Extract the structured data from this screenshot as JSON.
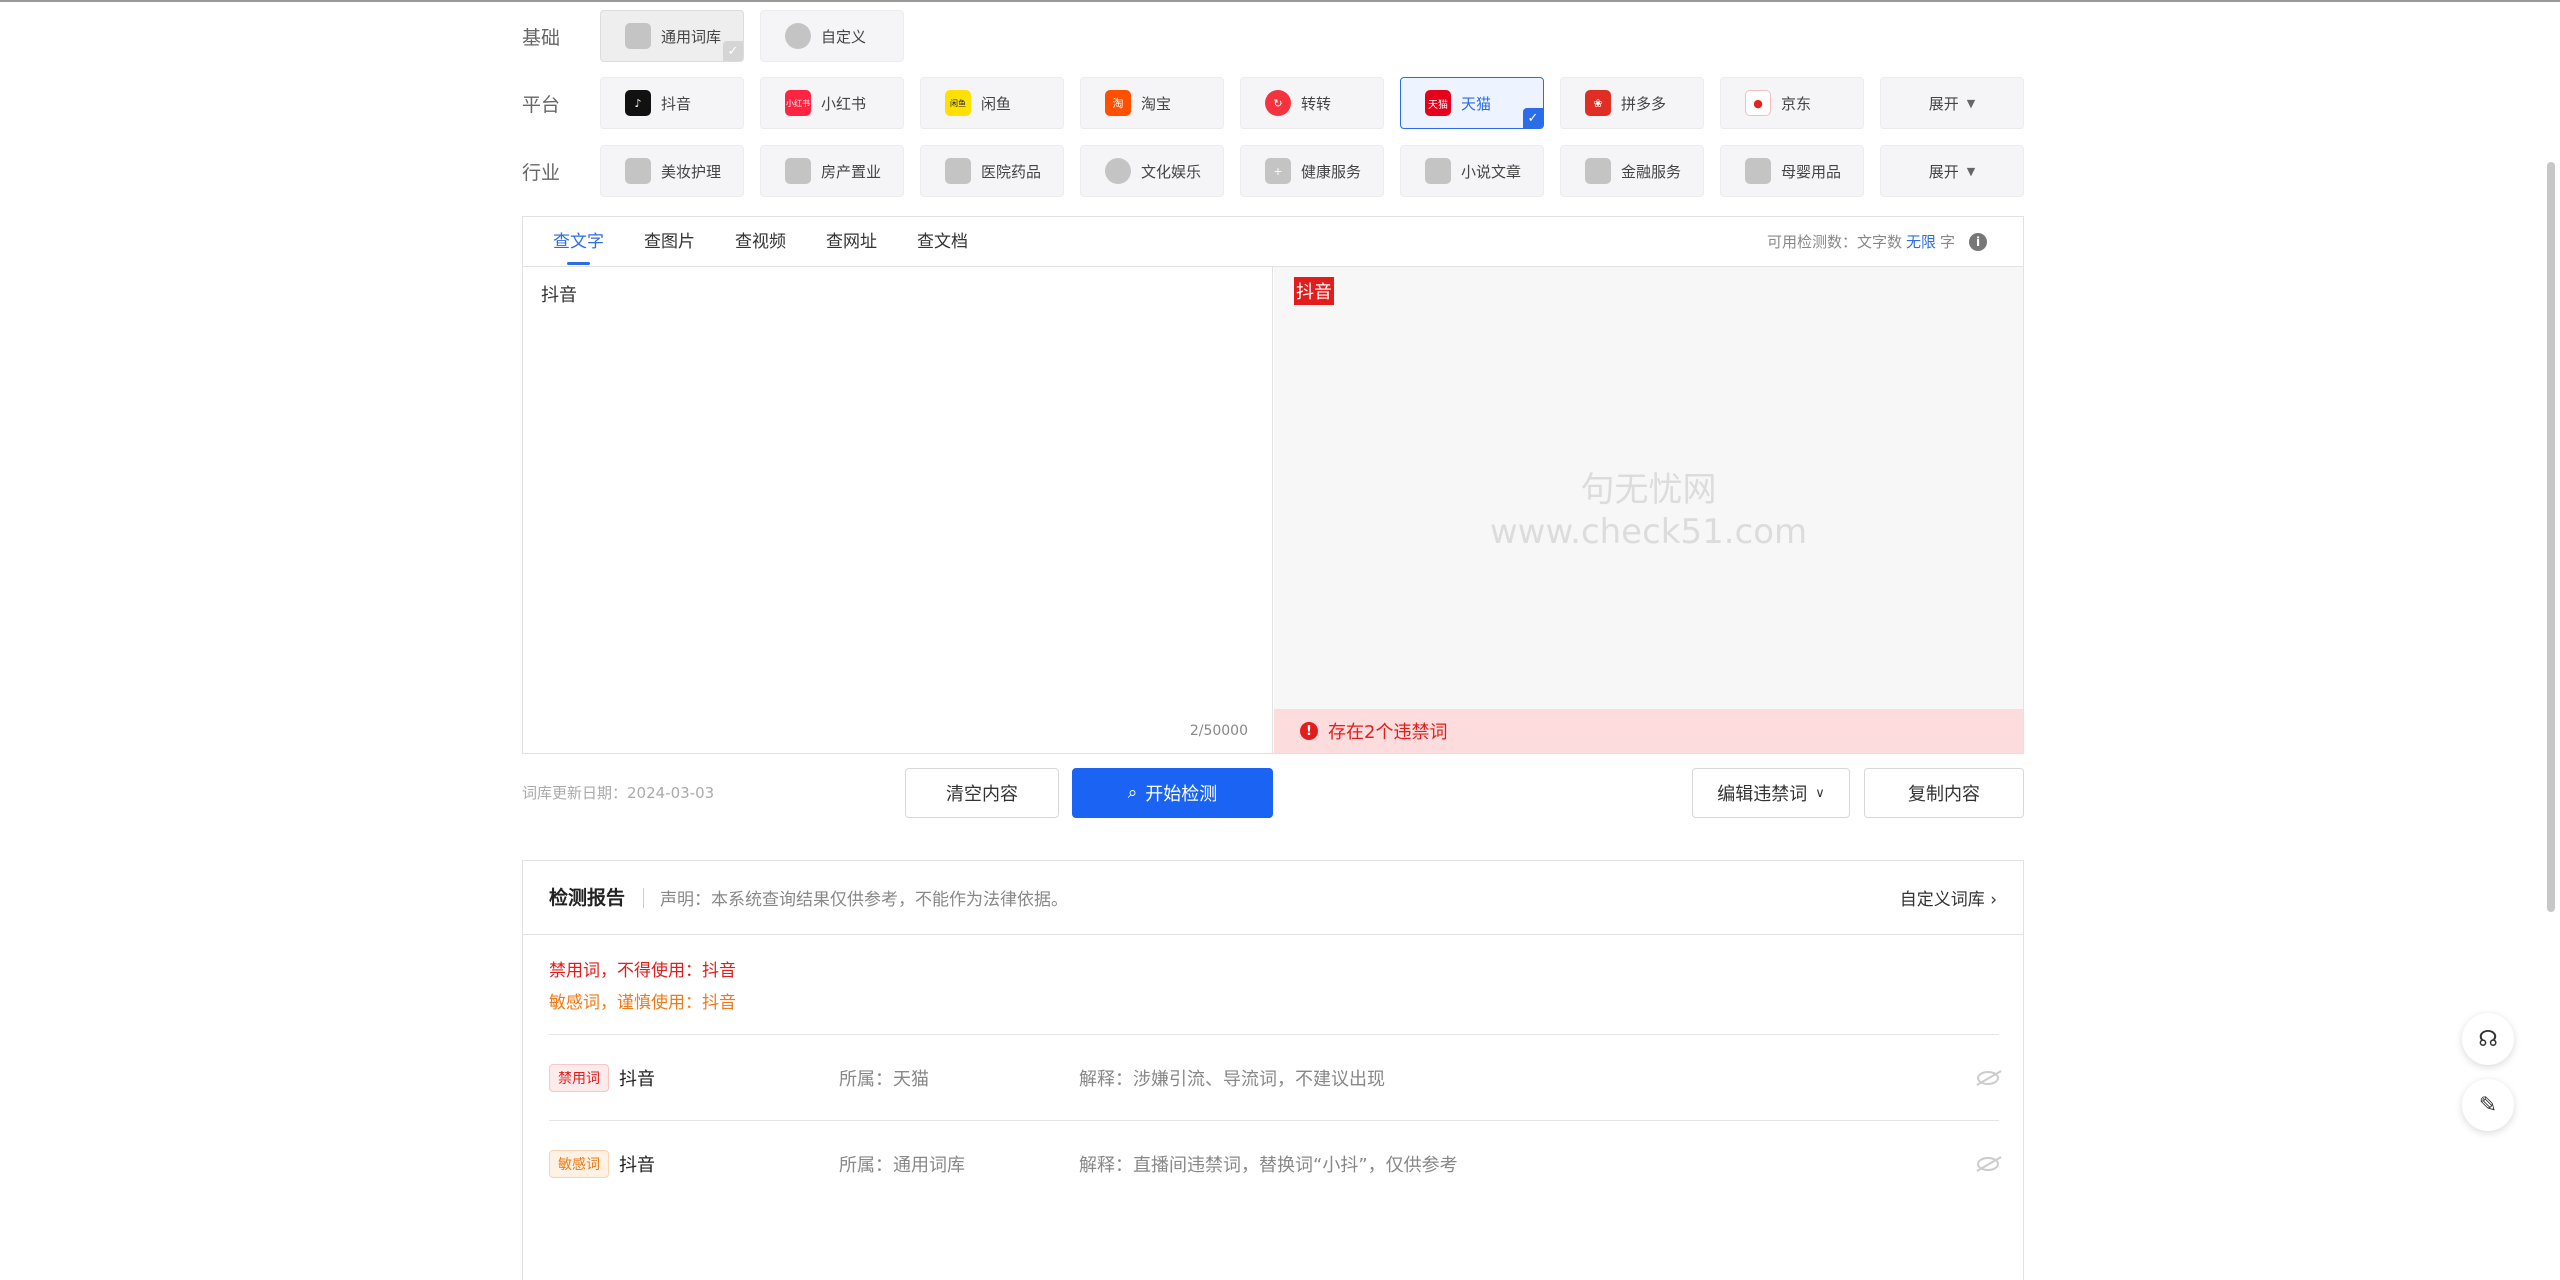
{
  "filters": {
    "base": {
      "label": "基础",
      "items": [
        {
          "name": "通用词库",
          "selected": true
        },
        {
          "name": "自定义",
          "selected": false
        }
      ]
    },
    "platform": {
      "label": "平台",
      "items": [
        {
          "name": "抖音",
          "color": "#111111",
          "icon": "douyin-icon"
        },
        {
          "name": "小红书",
          "color": "#ff2442",
          "icon": "xiaohongshu-icon"
        },
        {
          "name": "闲鱼",
          "color": "#ffe000",
          "icon": "xianyu-icon"
        },
        {
          "name": "淘宝",
          "color": "#ff5000",
          "icon": "taobao-icon"
        },
        {
          "name": "转转",
          "color": "#f5333f",
          "icon": "zhuanzhuan-icon"
        },
        {
          "name": "天猫",
          "color": "#e5001c",
          "icon": "tmall-icon",
          "selected": true
        },
        {
          "name": "拼多多",
          "color": "#e02e24",
          "icon": "pinduoduo-icon"
        },
        {
          "name": "京东",
          "color": "#e1251b",
          "icon": "jd-icon"
        }
      ],
      "expand": "展开"
    },
    "industry": {
      "label": "行业",
      "items": [
        {
          "name": "美妆护理"
        },
        {
          "name": "房产置业"
        },
        {
          "name": "医院药品"
        },
        {
          "name": "文化娱乐"
        },
        {
          "name": "健康服务"
        },
        {
          "name": "小说文章"
        },
        {
          "name": "金融服务"
        },
        {
          "name": "母婴用品"
        }
      ],
      "expand": "展开"
    }
  },
  "tabs": [
    "查文字",
    "查图片",
    "查视频",
    "查网址",
    "查文档"
  ],
  "quota": {
    "prefix": "可用检测数：文字数",
    "value": "无限",
    "suffix": "字"
  },
  "editor": {
    "text": "抖音",
    "count": "2/50000"
  },
  "result": {
    "highlight": "抖音",
    "watermark1": "句无忧网",
    "watermark2": "www.check51.com",
    "warning": "存在2个违禁词"
  },
  "actions": {
    "updated": "词库更新日期：2024-03-03",
    "clear": "清空内容",
    "start": "开始检测",
    "edit": "编辑违禁词",
    "copy": "复制内容"
  },
  "report": {
    "title": "检测报告",
    "disclaimer": "声明：本系统查询结果仅供参考，不能作为法律依据。",
    "custom_link": "自定义词库",
    "summary_banned": "禁用词，不得使用：抖音",
    "summary_sensitive": "敏感词，谨慎使用：抖音",
    "items": [
      {
        "tag": "禁用词",
        "word": "抖音",
        "source": "所属：天猫",
        "explain": "解释：涉嫌引流、导流词，不建议出现"
      },
      {
        "tag": "敏感词",
        "word": "抖音",
        "source": "所属：通用词库",
        "explain": "解释：直播间违禁词，替换词“小抖”，仅供参考"
      }
    ]
  }
}
